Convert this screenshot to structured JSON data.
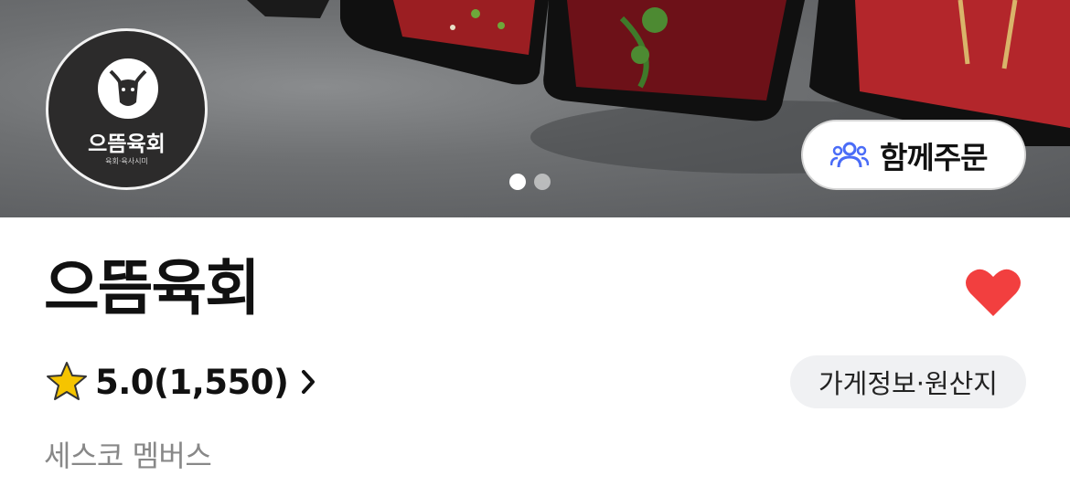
{
  "hero": {
    "logo": {
      "name": "으뜸육회",
      "tagline": "육회·육사시미"
    },
    "slides": {
      "total": 2,
      "active": 1
    },
    "group_order_label": "함께주문"
  },
  "store": {
    "name": "으뜸육회",
    "favorited": true,
    "rating": "5.0(1,550)",
    "info_button_label": "가게정보·원산지",
    "membership_text": "세스코 멤버스"
  },
  "colors": {
    "heart": "#f23f3f",
    "star": "#f5c400",
    "group_icon": "#4a6cf7",
    "member_text": "#888888"
  }
}
